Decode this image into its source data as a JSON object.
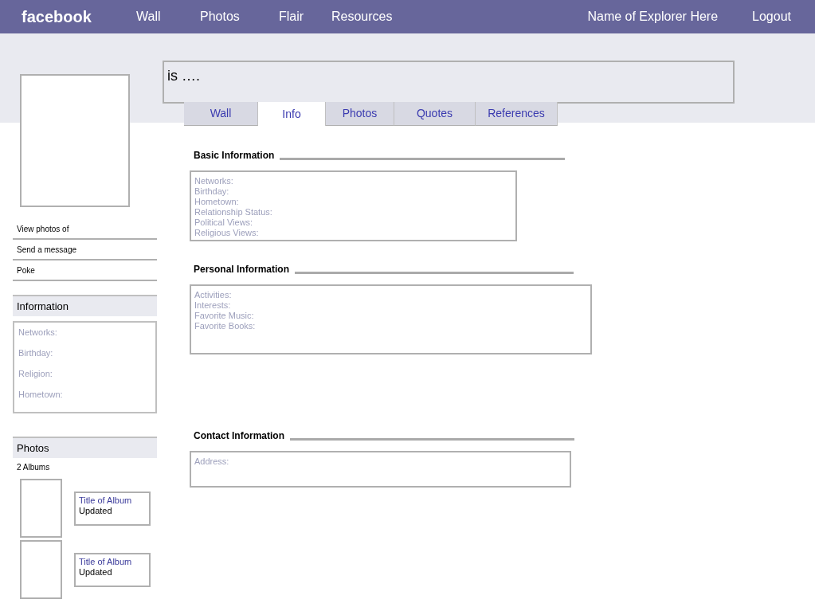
{
  "header": {
    "logo": "facebook",
    "nav": [
      "Wall",
      "Photos",
      "Flair",
      "Resources"
    ],
    "user": "Name of Explorer Here",
    "logout": "Logout"
  },
  "sidebar": {
    "actions": [
      "View photos of",
      "Send a message",
      "Poke"
    ],
    "information": {
      "title": "Information",
      "fields": [
        "Networks:",
        "Birthday:",
        "Religion:",
        "Hometown:"
      ]
    },
    "photos": {
      "title": "Photos",
      "count": "2 Albums",
      "albums": [
        {
          "title": "Title of Album",
          "subtitle": "Updated"
        },
        {
          "title": "Title of Album",
          "subtitle": "Updated"
        }
      ]
    }
  },
  "status": "is ….",
  "tabs": [
    {
      "label": "Wall",
      "selected": false
    },
    {
      "label": "Info",
      "selected": true
    },
    {
      "label": "Photos",
      "selected": false
    },
    {
      "label": "Quotes",
      "selected": false
    },
    {
      "label": "References",
      "selected": false
    }
  ],
  "sections": [
    {
      "title": "Basic Information",
      "fields": [
        "Networks:",
        "Birthday:",
        "Hometown:",
        "Relationship Status:",
        "Political Views:",
        "Religious Views:"
      ]
    },
    {
      "title": "Personal Information",
      "fields": [
        "Activities:",
        "Interests:",
        "Favorite Music:",
        "Favorite Books:"
      ]
    },
    {
      "title": "Contact Information",
      "fields": [
        "Address:"
      ]
    }
  ]
}
